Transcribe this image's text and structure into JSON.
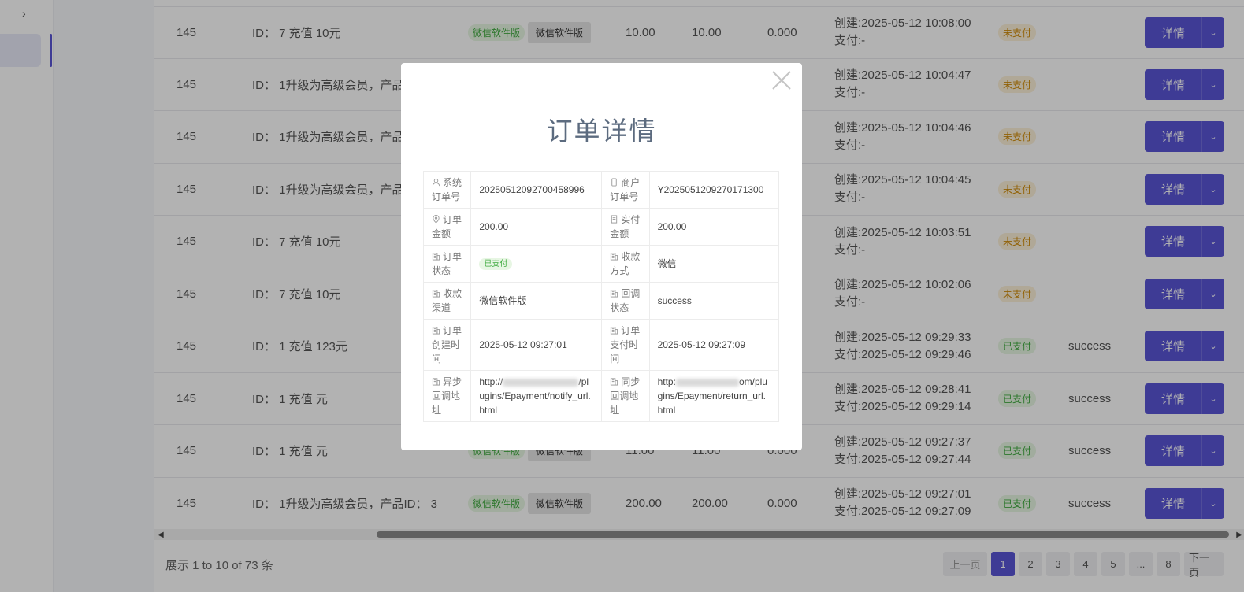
{
  "table": {
    "rows": [
      {
        "uid": "145",
        "name": "ID： 7 充值 10元",
        "ch1": "微信软件版",
        "ch2": "微信软件版",
        "amount": "10.00",
        "real": "10.00",
        "fee": "0.000",
        "created": "创建:2025-05-12 10:08:00",
        "paid": "支付:-",
        "status": "未支付",
        "status_type": "unpaid",
        "callback": "",
        "action": "详情"
      },
      {
        "uid": "145",
        "name": "ID： 1升级为高级会员，产品",
        "ch1": "",
        "ch2": "",
        "amount": "",
        "real": "",
        "fee": "",
        "created": "创建:2025-05-12 10:04:47",
        "paid": "支付:-",
        "status": "未支付",
        "status_type": "unpaid",
        "callback": "",
        "action": "详情"
      },
      {
        "uid": "145",
        "name": "ID： 1升级为高级会员，产品",
        "ch1": "",
        "ch2": "",
        "amount": "",
        "real": "",
        "fee": "",
        "created": "创建:2025-05-12 10:04:46",
        "paid": "支付:-",
        "status": "未支付",
        "status_type": "unpaid",
        "callback": "",
        "action": "详情"
      },
      {
        "uid": "145",
        "name": "ID： 1升级为高级会员，产品",
        "ch1": "",
        "ch2": "",
        "amount": "",
        "real": "",
        "fee": "",
        "created": "创建:2025-05-12 10:04:45",
        "paid": "支付:-",
        "status": "未支付",
        "status_type": "unpaid",
        "callback": "",
        "action": "详情"
      },
      {
        "uid": "145",
        "name": "ID： 7 充值 10元",
        "ch1": "",
        "ch2": "",
        "amount": "",
        "real": "",
        "fee": "",
        "created": "创建:2025-05-12 10:03:51",
        "paid": "支付:-",
        "status": "未支付",
        "status_type": "unpaid",
        "callback": "",
        "action": "详情"
      },
      {
        "uid": "145",
        "name": "ID： 7 充值 10元",
        "ch1": "",
        "ch2": "",
        "amount": "",
        "real": "",
        "fee": "",
        "created": "创建:2025-05-12 10:02:06",
        "paid": "支付:-",
        "status": "未支付",
        "status_type": "unpaid",
        "callback": "",
        "action": "详情"
      },
      {
        "uid": "145",
        "name": "ID： 1 充值 123元",
        "ch1": "",
        "ch2": "",
        "amount": "",
        "real": "",
        "fee": "",
        "created": "创建:2025-05-12 09:29:33",
        "paid": "支付:2025-05-12 09:29:46",
        "status": "已支付",
        "status_type": "paid",
        "callback": "success",
        "action": "详情"
      },
      {
        "uid": "145",
        "name": "ID： 1 充值 元",
        "ch1": "",
        "ch2": "",
        "amount": "",
        "real": "",
        "fee": "",
        "created": "创建:2025-05-12 09:28:41",
        "paid": "支付:2025-05-12 09:29:14",
        "status": "已支付",
        "status_type": "paid",
        "callback": "success",
        "action": "详情"
      },
      {
        "uid": "145",
        "name": "ID： 1 充值 元",
        "ch1": "微信软件版",
        "ch2": "微信软件版",
        "amount": "11.00",
        "real": "11.00",
        "fee": "0.000",
        "created": "创建:2025-05-12 09:27:37",
        "paid": "支付:2025-05-12 09:27:44",
        "status": "已支付",
        "status_type": "paid",
        "callback": "success",
        "action": "详情"
      },
      {
        "uid": "145",
        "name": "ID： 1升级为高级会员，产品ID： 3",
        "ch1": "微信软件版",
        "ch2": "微信软件版",
        "amount": "200.00",
        "real": "200.00",
        "fee": "0.000",
        "created": "创建:2025-05-12 09:27:01",
        "paid": "支付:2025-05-12 09:27:09",
        "status": "已支付",
        "status_type": "paid",
        "callback": "success",
        "action": "详情"
      }
    ]
  },
  "footer": {
    "info": "展示 1 to 10 of 73 条",
    "pager": {
      "prev": "上一页",
      "pages": [
        "1",
        "2",
        "3",
        "4",
        "5",
        "...",
        "8"
      ],
      "active": "1",
      "next": "下一页"
    }
  },
  "modal": {
    "title": "订单详情",
    "rows": [
      {
        "k1": "系统订单号",
        "i1": "user-icon",
        "v1": "20250512092700458996",
        "k2": "商户订单号",
        "i2": "phone-icon",
        "v2": "Y20250512092701713​00"
      },
      {
        "k1": "订单金额",
        "i1": "location-icon",
        "v1": "200.00",
        "k2": "实付金额",
        "i2": "document-icon",
        "v2": "200.00"
      },
      {
        "k1": "订单状态",
        "i1": "building-icon",
        "v1": "已支付",
        "k2": "收款方式",
        "i2": "building-icon",
        "v2": "微信"
      },
      {
        "k1": "收款渠道",
        "i1": "building-icon",
        "v1": "微信软件版",
        "k2": "回调状态",
        "i2": "building-icon",
        "v2": "success"
      },
      {
        "k1": "订单创建时间",
        "i1": "building-icon",
        "v1": "2025-05-12 09:27:01",
        "k2": "订单支付时间",
        "i2": "building-icon",
        "v2": "2025-05-12 09:27:09"
      },
      {
        "k1": "异步回调地址",
        "i1": "building-icon",
        "v1a": "http://",
        "v1b": "/plugins/Epayment/notify_url.html",
        "k2": "同步回调地址",
        "i2": "building-icon",
        "v2a": "http:",
        "v2b": "om/plugins/Epayment/return_url.html"
      }
    ]
  },
  "colors": {
    "accent": "#5a55d6",
    "paid": "#3fab3f",
    "unpaid": "#d08b08"
  }
}
